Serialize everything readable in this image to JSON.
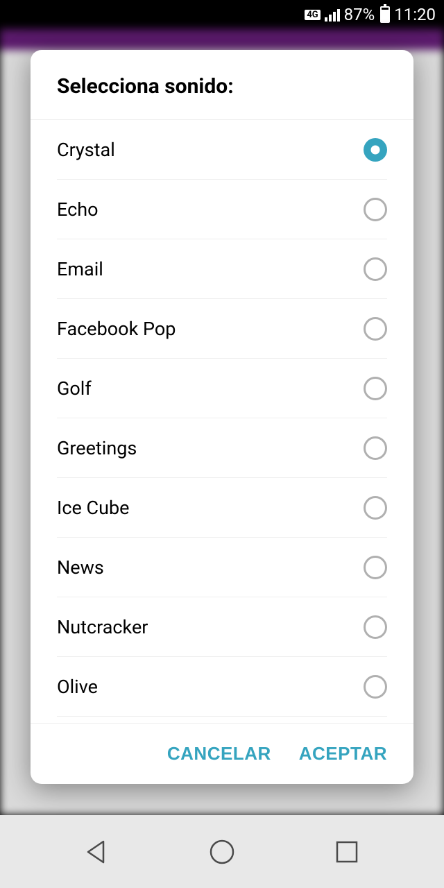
{
  "status": {
    "network": "4G",
    "battery_pct": "87%",
    "time": "11:20"
  },
  "dialog": {
    "title": "Selecciona sonido:",
    "options": [
      {
        "label": "Crystal",
        "selected": true
      },
      {
        "label": "Echo",
        "selected": false
      },
      {
        "label": "Email",
        "selected": false
      },
      {
        "label": "Facebook Pop",
        "selected": false
      },
      {
        "label": "Golf",
        "selected": false
      },
      {
        "label": "Greetings",
        "selected": false
      },
      {
        "label": "Ice Cube",
        "selected": false
      },
      {
        "label": "News",
        "selected": false
      },
      {
        "label": "Nutcracker",
        "selected": false
      },
      {
        "label": "Olive",
        "selected": false
      }
    ],
    "cancel_label": "CANCELAR",
    "accept_label": "ACEPTAR"
  }
}
